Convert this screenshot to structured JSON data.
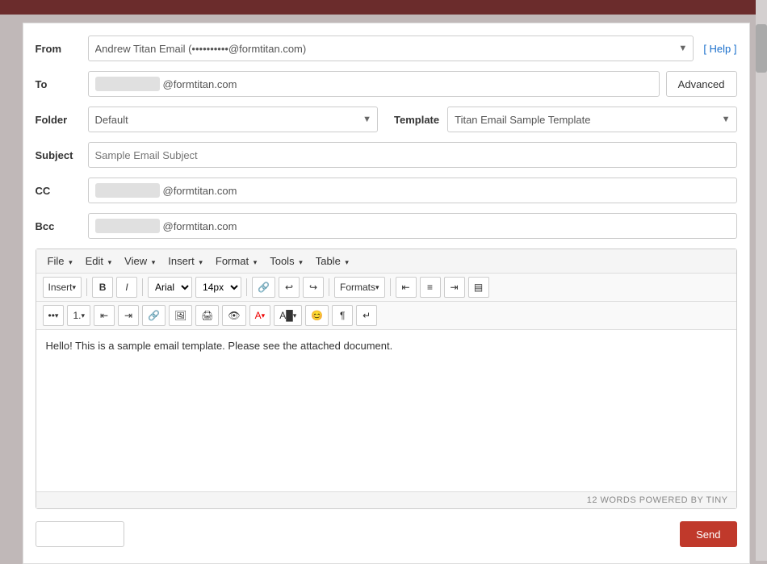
{
  "topbar": {
    "background": "#6b2c2c"
  },
  "form": {
    "from_label": "From",
    "from_value": "Andrew Titan Email (",
    "from_domain": "@formtitan.com)",
    "from_masked_placeholder": "",
    "help_label": "[ Help ]",
    "to_label": "To",
    "to_domain": "@formtitan.com",
    "advanced_label": "Advanced",
    "folder_label": "Folder",
    "folder_value": "Default",
    "template_label": "Template",
    "template_value": "Titan Email Sample Template",
    "subject_label": "Subject",
    "subject_placeholder": "Sample Email Subject",
    "cc_label": "CC",
    "cc_domain": "@formtitan.com",
    "bcc_label": "Bcc",
    "bcc_domain": "@formtitan.com"
  },
  "editor": {
    "menu_items": [
      {
        "label": "File",
        "has_arrow": true
      },
      {
        "label": "Edit",
        "has_arrow": true
      },
      {
        "label": "View",
        "has_arrow": true
      },
      {
        "label": "Insert",
        "has_arrow": true
      },
      {
        "label": "Format",
        "has_arrow": true
      },
      {
        "label": "Tools",
        "has_arrow": true
      },
      {
        "label": "Table",
        "has_arrow": true
      }
    ],
    "toolbar": {
      "insert_label": "Insert",
      "bold_label": "B",
      "italic_label": "I",
      "font_family": "Arial",
      "font_size": "14px",
      "formats_label": "Formats"
    },
    "body_text": "Hello! This is a sample email template. Please see the attached document.",
    "footer_text": "12 WORDS POWERED BY TINY"
  },
  "bottom": {
    "send_label": "Send"
  }
}
